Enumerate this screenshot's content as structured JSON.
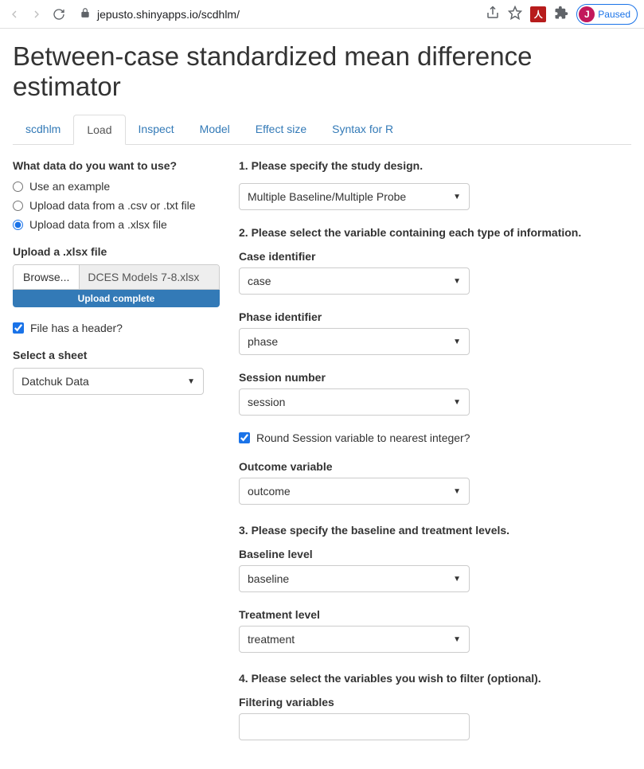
{
  "browser": {
    "url": "jepusto.shinyapps.io/scdhlm/",
    "profile_letter": "J",
    "profile_status": "Paused"
  },
  "page_title": "Between-case standardized mean difference estimator",
  "tabs": [
    "scdhlm",
    "Load",
    "Inspect",
    "Model",
    "Effect size",
    "Syntax for R"
  ],
  "active_tab": "Load",
  "sidebar": {
    "question": "What data do you want to use?",
    "options": [
      "Use an example",
      "Upload data from a .csv or .txt file",
      "Upload data from a .xlsx file"
    ],
    "selected_index": 2,
    "upload_label": "Upload a .xlsx file",
    "browse_btn": "Browse...",
    "file_name": "DCES Models 7-8.xlsx",
    "upload_status": "Upload complete",
    "header_checkbox_label": "File has a header?",
    "header_checked": true,
    "sheet_label": "Select a sheet",
    "sheet_value": "Datchuk Data"
  },
  "main": {
    "step1_heading": "1. Please specify the study design.",
    "design_value": "Multiple Baseline/Multiple Probe",
    "step2_heading": "2. Please select the variable containing each type of information.",
    "case_label": "Case identifier",
    "case_value": "case",
    "phase_label": "Phase identifier",
    "phase_value": "phase",
    "session_label": "Session number",
    "session_value": "session",
    "round_label": "Round Session variable to nearest integer?",
    "round_checked": true,
    "outcome_label": "Outcome variable",
    "outcome_value": "outcome",
    "step3_heading": "3. Please specify the baseline and treatment levels.",
    "baseline_label": "Baseline level",
    "baseline_value": "baseline",
    "treatment_label": "Treatment level",
    "treatment_value": "treatment",
    "step4_heading": "4. Please select the variables you wish to filter (optional).",
    "filter_label": "Filtering variables"
  }
}
